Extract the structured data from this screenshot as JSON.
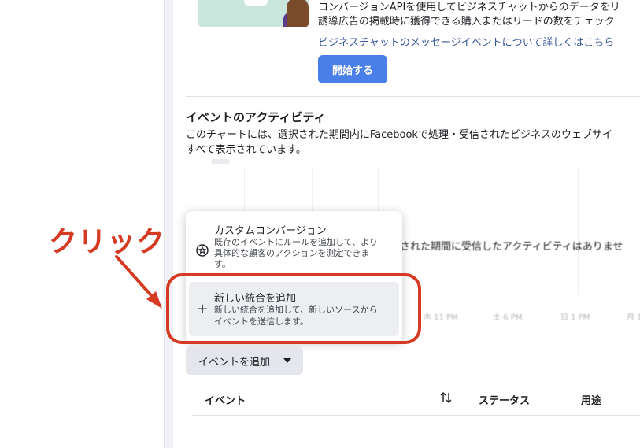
{
  "promo": {
    "line1": "コンバージョンAPIを使用してビジネスチャットからのデータをリ",
    "line2": "誘導広告の掲載時に獲得できる購入またはリードの数をチェック",
    "link": "ビジネスチャットのメッセージイベントについて詳しくはこちら",
    "start_button": "開始する"
  },
  "activity": {
    "title": "イベントのアクティビティ",
    "desc_line1": "このチャートには、選択された期間内にFacebookで処理・受信されたビジネスのウェブサイ",
    "desc_line2": "すべて表示されています。",
    "no_activity": "された期間に受信したアクティビティはありませ",
    "x_ticks": [
      "木 11 PM",
      "土 6 PM",
      "日 1 PM",
      "月 1"
    ]
  },
  "menu": {
    "items": [
      {
        "icon": "star-circle-icon",
        "title": "カスタムコンバージョン",
        "sub1": "既存のイベントにルールを追加して、より",
        "sub2": "具体的な顧客のアクションを測定できま",
        "sub3": "す。"
      },
      {
        "icon": "plus-icon",
        "title": "新しい統合を追加",
        "sub1": "新しい統合を追加して、新しいソースから",
        "sub2": "イベントを送信します。"
      }
    ]
  },
  "add_event_button": "イベントを追加",
  "table": {
    "headers": [
      "イベント",
      "ステータス",
      "用途"
    ]
  },
  "annotation": {
    "label": "クリック",
    "color": "#d63a22"
  }
}
